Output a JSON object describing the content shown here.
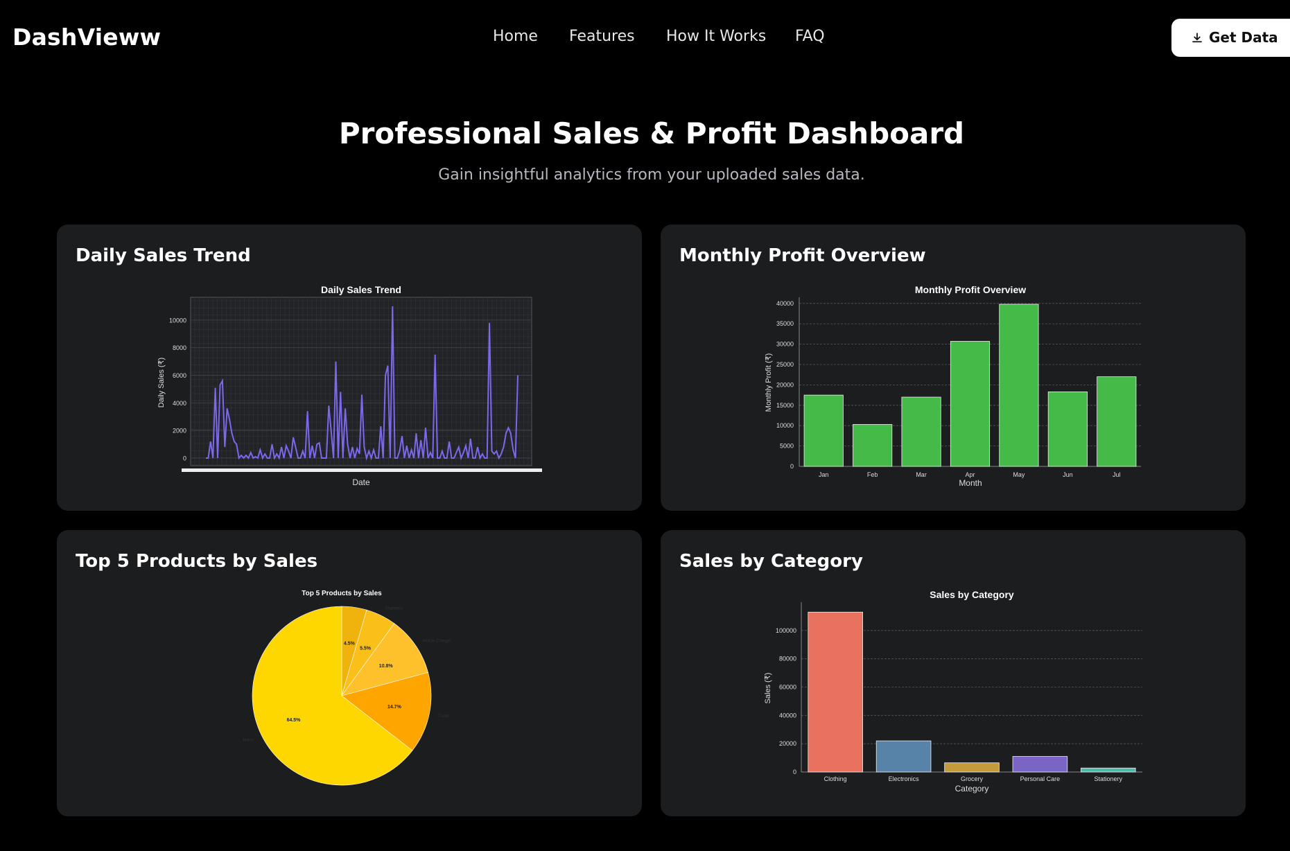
{
  "header": {
    "brand": "DashVieww",
    "nav": [
      "Home",
      "Features",
      "How It Works",
      "FAQ"
    ],
    "cta": "Get Data",
    "cta_icon": "download-icon"
  },
  "hero": {
    "title": "Professional Sales & Profit Dashboard",
    "subtitle": "Gain insightful analytics from your uploaded sales data."
  },
  "cards": [
    {
      "title": "Daily Sales Trend"
    },
    {
      "title": "Monthly Profit Overview"
    },
    {
      "title": "Top 5 Products by Sales"
    },
    {
      "title": "Sales by Category"
    }
  ],
  "chart_data": [
    {
      "type": "line",
      "title": "Daily Sales Trend",
      "xlabel": "Date",
      "ylabel": "Daily Sales (₹)",
      "ylim": [
        0,
        11000
      ],
      "yticks": [
        0,
        2000,
        4000,
        6000,
        8000,
        10000
      ],
      "grid": true,
      "color": "#7b68ee",
      "values": [
        0,
        0,
        1200,
        0,
        5100,
        0,
        5300,
        5600,
        800,
        3600,
        2800,
        1800,
        1200,
        1000,
        0,
        200,
        0,
        200,
        0,
        400,
        0,
        100,
        0,
        600,
        0,
        300,
        0,
        0,
        1000,
        0,
        300,
        0,
        800,
        0,
        900,
        500,
        0,
        1500,
        800,
        0,
        0,
        500,
        0,
        3400,
        0,
        900,
        0,
        1000,
        1100,
        0,
        0,
        0,
        3800,
        2000,
        0,
        7000,
        0,
        4800,
        0,
        3600,
        1000,
        0,
        800,
        0,
        700,
        300,
        4600,
        800,
        0,
        500,
        0,
        600,
        0,
        0,
        2300,
        0,
        6000,
        6700,
        0,
        11000,
        0,
        0,
        500,
        1600,
        0,
        900,
        0,
        600,
        0,
        1800,
        0,
        1300,
        0,
        2200,
        0,
        400,
        0,
        7500,
        0,
        0,
        500,
        0,
        0,
        1200,
        0,
        0,
        400,
        800,
        0,
        400,
        900,
        0,
        1400,
        0,
        0,
        800,
        0,
        300,
        0,
        0,
        9800,
        500,
        300,
        500,
        0,
        300,
        800,
        1800,
        2200,
        1800,
        600,
        0,
        6000
      ]
    },
    {
      "type": "bar",
      "title": "Monthly Profit Overview",
      "xlabel": "Month",
      "ylabel": "Monthly Profit (₹)",
      "categories": [
        "Jan",
        "Feb",
        "Mar",
        "Apr",
        "May",
        "Jun",
        "Jul"
      ],
      "values": [
        17500,
        10300,
        17000,
        30700,
        39800,
        18300,
        22000
      ],
      "ylim": [
        0,
        41500
      ],
      "yticks": [
        0,
        5000,
        10000,
        15000,
        20000,
        25000,
        30000,
        35000,
        40000
      ],
      "color": "#44bb48"
    },
    {
      "type": "pie",
      "title": "Top 5 Products by Sales",
      "slices": [
        {
          "label": "",
          "value": 4.5,
          "pct": "4.5%",
          "color": "#f0b30e"
        },
        {
          "label": "Shampoo",
          "value": 5.5,
          "pct": "5.5%",
          "color": "#fbbf1a"
        },
        {
          "label": "Mobile Charger",
          "value": 10.8,
          "pct": "10.8%",
          "color": "#ffc12b"
        },
        {
          "label": "T-shirt",
          "value": 14.7,
          "pct": "14.7%",
          "color": "#ffa500"
        },
        {
          "label": "Jeans",
          "value": 64.5,
          "pct": "64.5%",
          "color": "#ffd700"
        }
      ]
    },
    {
      "type": "bar",
      "title": "Sales by Category",
      "xlabel": "Category",
      "ylabel": "Sales (₹)",
      "categories": [
        "Clothing",
        "Electronics",
        "Grocery",
        "Personal Care",
        "Stationery"
      ],
      "values": [
        113000,
        22000,
        6500,
        11000,
        2800
      ],
      "colors": [
        "#e8725f",
        "#5783a8",
        "#c49a3a",
        "#7a64c4",
        "#4fb8a8"
      ],
      "ylim": [
        0,
        120000
      ],
      "yticks": [
        0,
        20000,
        40000,
        60000,
        80000,
        100000
      ]
    }
  ]
}
